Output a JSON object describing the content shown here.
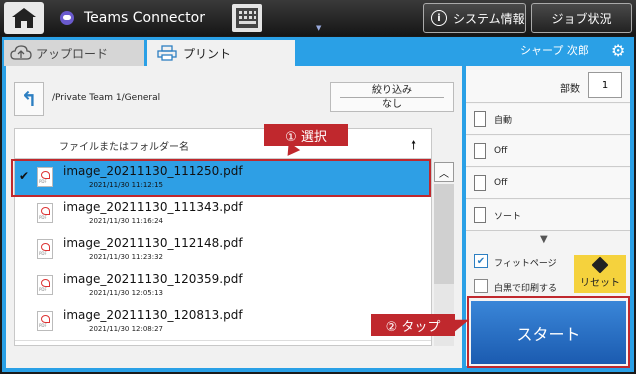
{
  "topbar": {
    "app_title": "Teams Connector",
    "system_info_label": "システム情報",
    "job_status_label": "ジョブ状況"
  },
  "tabs": {
    "upload_label": "アップロード",
    "print_label": "プリント"
  },
  "user_label": "シャープ 次郎",
  "browser": {
    "path": "/Private Team 1/General",
    "filter_label": "絞り込み",
    "filter_value": "なし",
    "column_header": "ファイルまたはフォルダー名",
    "files": [
      {
        "name": "image_20211130_111250.pdf",
        "date": "2021/11/30 11:12:15",
        "selected": true
      },
      {
        "name": "image_20211130_111343.pdf",
        "date": "2021/11/30 11:16:24",
        "selected": false
      },
      {
        "name": "image_20211130_112148.pdf",
        "date": "2021/11/30 11:23:32",
        "selected": false
      },
      {
        "name": "image_20211130_120359.pdf",
        "date": "2021/11/30 12:05:13",
        "selected": false
      },
      {
        "name": "image_20211130_120813.pdf",
        "date": "2021/11/30 12:08:27",
        "selected": false
      }
    ]
  },
  "settings": {
    "copies_label": "部数",
    "copies_value": "1",
    "color_mode": "自動",
    "duplex": "Off",
    "n_up": "Off",
    "sort": "ソート",
    "fit_page_label": "フィットページ",
    "fit_page_checked": true,
    "bw_print_label": "白黒で印刷する",
    "bw_print_checked": false,
    "reset_label": "リセット",
    "start_label": "スタート"
  },
  "annotations": {
    "step1": "① 選択",
    "step2": "② タップ"
  },
  "colors": {
    "accent_blue": "#2aa0e6",
    "selection_blue": "#2e9fe5",
    "callout_red": "#c0282d",
    "reset_yellow": "#f5d23d",
    "start_blue": "#2a6fc8"
  }
}
